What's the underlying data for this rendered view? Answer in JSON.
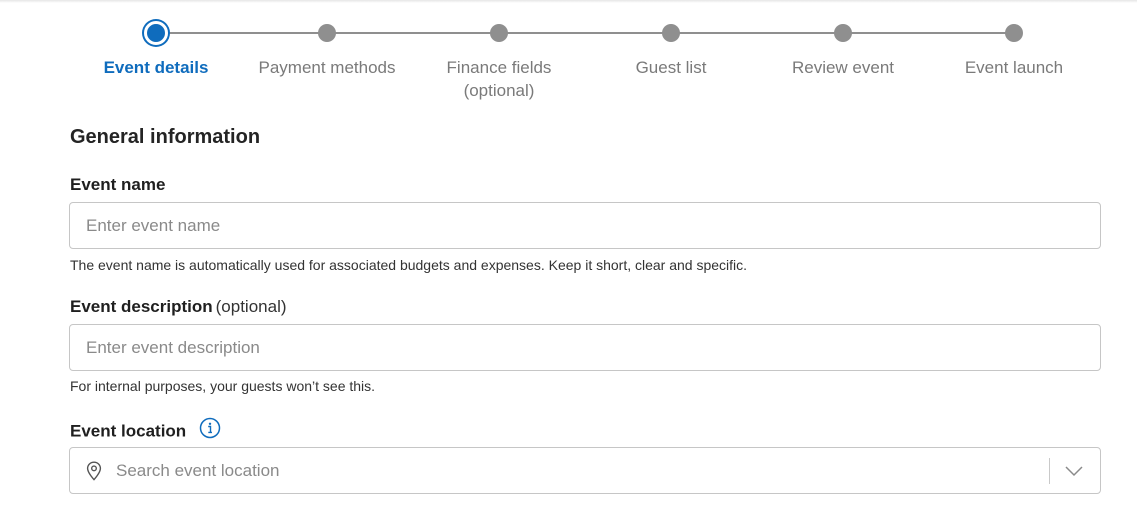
{
  "stepper": {
    "steps": [
      {
        "label": "Event details",
        "state": "active"
      },
      {
        "label": "Payment methods",
        "state": "upcoming"
      },
      {
        "label": "Finance fields (optional)",
        "label_line1": "Finance fields",
        "label_line2": "(optional)",
        "state": "upcoming"
      },
      {
        "label": "Guest list",
        "state": "upcoming"
      },
      {
        "label": "Review event",
        "state": "upcoming"
      },
      {
        "label": "Event launch",
        "state": "upcoming"
      }
    ]
  },
  "form": {
    "section_title": "General information",
    "event_name": {
      "label": "Event name",
      "placeholder": "Enter event name",
      "value": "",
      "helper": "The event name is automatically used for associated budgets and expenses. Keep it short, clear and specific."
    },
    "event_description": {
      "label": "Event description",
      "optional_suffix": "(optional)",
      "placeholder": "Enter event description",
      "value": "",
      "helper": "For internal purposes, your guests won’t see this."
    },
    "event_location": {
      "label": "Event location",
      "placeholder": "Search event location",
      "value": "",
      "icons": [
        "info-icon",
        "location-pin-icon",
        "chevron-down-icon"
      ]
    }
  },
  "colors": {
    "accent": "#0f6cbd",
    "inactive_step": "#8f8f8f",
    "border": "#c6c6c6"
  }
}
